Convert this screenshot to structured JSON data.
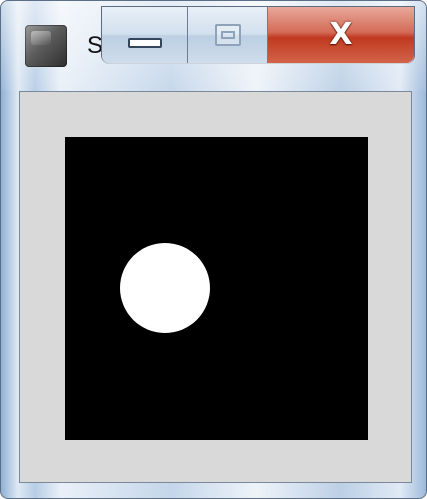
{
  "window": {
    "title": "S",
    "minimize_glyph": "minimize-icon",
    "maximize_glyph": "maximize-icon",
    "close_label": "X"
  },
  "canvas": {
    "background_color": "#000000",
    "ball_color": "#ffffff"
  },
  "colors": {
    "client_background": "#d9d9d9",
    "close_button": "#c0391f"
  }
}
